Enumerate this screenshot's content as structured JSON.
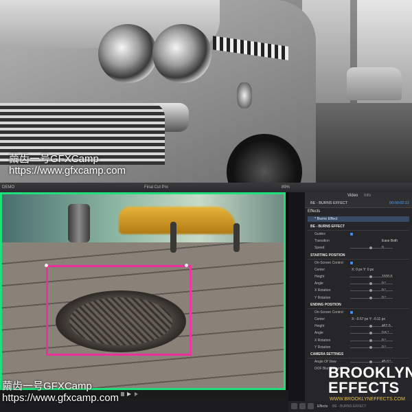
{
  "photo": {
    "watermark_line1": "繭齿一号GFXCamp",
    "watermark_line2": "https://www.gfxcamp.com"
  },
  "editor": {
    "titlebar": {
      "left": "DEMO",
      "center": "Final Cut Pro",
      "zoom": "89%"
    },
    "watermark_line1": "繭齿一号GFXCamp",
    "watermark_line2": "https://www.gfxcamp.com"
  },
  "inspector": {
    "tabs": [
      "Video",
      "Info"
    ],
    "clip_name": "BE - BURNS EFFECT",
    "timecode": "00:00:02:12",
    "section_effects": "Effects",
    "effect_name": "* Burns Effect",
    "params": [
      {
        "label": "BE - BURNS EFFECT",
        "value": ""
      },
      {
        "label": "Guides",
        "value": ""
      },
      {
        "label": "Transition",
        "value": "Ease Both"
      },
      {
        "label": "Speed",
        "value": "0"
      },
      {
        "label": "STARTING POSITION",
        "value": ""
      },
      {
        "label": "On-Screen Control",
        "value": ""
      },
      {
        "label": "Center",
        "value": "X: 0 px  Y: 0 px"
      },
      {
        "label": "Height",
        "value": "1070.0"
      },
      {
        "label": "Angle",
        "value": "0 °"
      },
      {
        "label": "X Rotation",
        "value": "0 °"
      },
      {
        "label": "Y Rotation",
        "value": "0 °"
      },
      {
        "label": "ENDING POSITION",
        "value": ""
      },
      {
        "label": "On-Screen Control",
        "value": ""
      },
      {
        "label": "Center",
        "value": "X: -0.57 px  Y: -0.11 px"
      },
      {
        "label": "Height",
        "value": "467.0"
      },
      {
        "label": "Angle",
        "value": "0.6 °"
      },
      {
        "label": "X Rotation",
        "value": "0 °"
      },
      {
        "label": "Y Rotation",
        "value": "0 °"
      },
      {
        "label": "CAMERA SETTINGS",
        "value": ""
      },
      {
        "label": "Angle Of View",
        "value": "45.0 °"
      },
      {
        "label": "DOF Blur Amount",
        "value": ""
      }
    ],
    "dock": {
      "effects_label": "Effects",
      "burns_label": "BE - BURNS EFFECT"
    }
  },
  "brand": {
    "line1": "BROOKLYN",
    "line2": "EFFECTS",
    "url": "WWW.BROOKLYNEFFECTS.COM"
  },
  "colors": {
    "selection": "#ee2f9a",
    "viewer_border": "#1ee07a",
    "accent": "#3b8cff",
    "brand_url": "#e7c14b"
  }
}
